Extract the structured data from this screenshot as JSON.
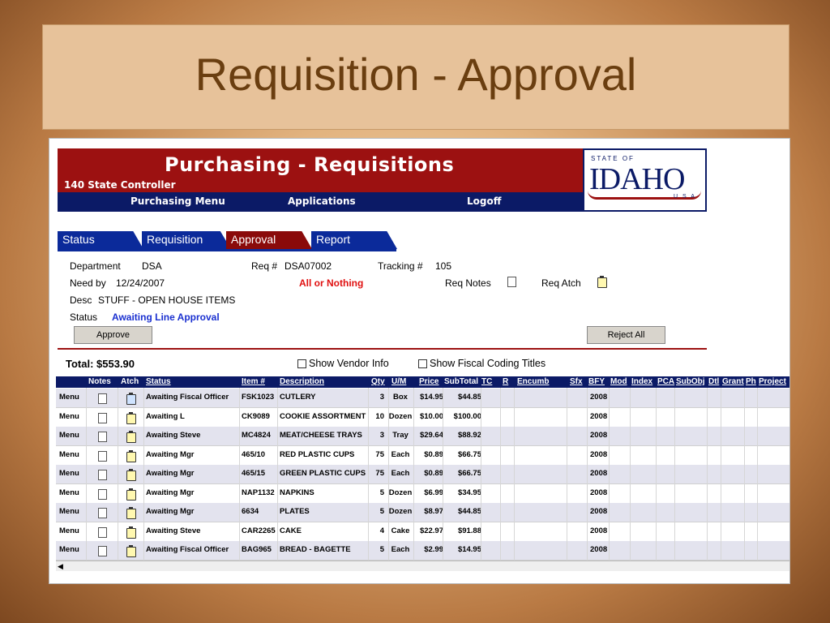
{
  "slide": {
    "title": "Requisition - Approval"
  },
  "header": {
    "title": "Purchasing - Requisitions",
    "agency": "140 State Controller",
    "nav": [
      "Purchasing Menu",
      "Applications",
      "Logoff"
    ],
    "logo": {
      "state_of": "STATE OF",
      "name": "IDAHO",
      "usa": "U S A"
    }
  },
  "tabs": [
    {
      "label": "Status",
      "active": false
    },
    {
      "label": "Requisition",
      "active": false
    },
    {
      "label": "Approval",
      "active": true
    },
    {
      "label": "Report",
      "active": false
    }
  ],
  "form": {
    "department_label": "Department",
    "department_value": "DSA",
    "req_label": "Req #",
    "req_value": "DSA07002",
    "tracking_label": "Tracking #",
    "tracking_value": "105",
    "need_by_label": "Need by",
    "need_by_value": "12/24/2007",
    "all_or_nothing": "All or Nothing",
    "req_notes_label": "Req Notes",
    "req_atch_label": "Req Atch",
    "desc_label": "Desc",
    "desc_value": "STUFF - OPEN HOUSE ITEMS",
    "status_label": "Status",
    "status_value": "Awaiting Line Approval",
    "approve_button": "Approve",
    "reject_button": "Reject All"
  },
  "summary": {
    "total": "Total: $553.90",
    "show_vendor_info": "Show Vendor Info",
    "show_fiscal_coding": "Show Fiscal Coding Titles"
  },
  "grid": {
    "columns": [
      "Notes",
      "Atch",
      "Status",
      "Item #",
      "Description",
      "Qty",
      "U/M",
      "Price",
      "SubTotal",
      "TC",
      "R",
      "Encumb",
      "Sfx",
      "BFY",
      "Mod",
      "Index",
      "PCA",
      "SubObj",
      "Dtl",
      "Grant",
      "Ph",
      "Project"
    ],
    "rows": [
      {
        "menu": "Menu",
        "status": "Awaiting Fiscal Officer",
        "item": "FSK1023",
        "desc": "CUTLERY",
        "qty": "3",
        "um": "Box",
        "price": "$14.95",
        "subtotal": "$44.85",
        "bfy": "2008"
      },
      {
        "menu": "Menu",
        "status": "Awaiting L",
        "item": "CK9089",
        "desc": "COOKIE ASSORTMENT",
        "qty": "10",
        "um": "Dozen",
        "price": "$10.00",
        "subtotal": "$100.00",
        "bfy": "2008"
      },
      {
        "menu": "Menu",
        "status": "Awaiting Steve",
        "item": "MC4824",
        "desc": "MEAT/CHEESE TRAYS",
        "qty": "3",
        "um": "Tray",
        "price": "$29.64",
        "subtotal": "$88.92",
        "bfy": "2008"
      },
      {
        "menu": "Menu",
        "status": "Awaiting Mgr",
        "item": "465/10",
        "desc": "RED PLASTIC CUPS",
        "qty": "75",
        "um": "Each",
        "price": "$0.89",
        "subtotal": "$66.75",
        "bfy": "2008"
      },
      {
        "menu": "Menu",
        "status": "Awaiting Mgr",
        "item": "465/15",
        "desc": "GREEN PLASTIC CUPS",
        "qty": "75",
        "um": "Each",
        "price": "$0.89",
        "subtotal": "$66.75",
        "bfy": "2008"
      },
      {
        "menu": "Menu",
        "status": "Awaiting Mgr",
        "item": "NAP1132",
        "desc": "NAPKINS",
        "qty": "5",
        "um": "Dozen",
        "price": "$6.99",
        "subtotal": "$34.95",
        "bfy": "2008"
      },
      {
        "menu": "Menu",
        "status": "Awaiting Mgr",
        "item": "6634",
        "desc": "PLATES",
        "qty": "5",
        "um": "Dozen",
        "price": "$8.97",
        "subtotal": "$44.85",
        "bfy": "2008"
      },
      {
        "menu": "Menu",
        "status": "Awaiting Steve",
        "item": "CAR2265",
        "desc": "CAKE",
        "qty": "4",
        "um": "Cake",
        "price": "$22.97",
        "subtotal": "$91.88",
        "bfy": "2008"
      },
      {
        "menu": "Menu",
        "status": "Awaiting Fiscal Officer",
        "item": "BAG965",
        "desc": "BREAD - BAGETTE",
        "qty": "5",
        "um": "Each",
        "price": "$2.99",
        "subtotal": "$14.95",
        "bfy": "2008"
      }
    ]
  },
  "colors": {
    "header_red": "#9c1111",
    "nav_blue": "#0b1a66",
    "tab_blue": "#0b2a9a",
    "status_blue": "#1a30d0",
    "alert_red": "#e01010"
  }
}
